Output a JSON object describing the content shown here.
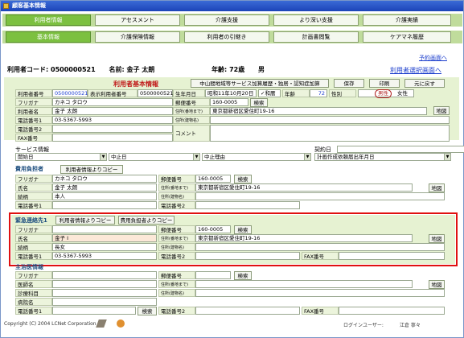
{
  "window": {
    "title": "顧客基本情報"
  },
  "nav1": [
    "利用者情報",
    "アセスメント",
    "介護支援",
    "より深い支援",
    "介護実績"
  ],
  "nav2": [
    "基本情報",
    "介護保険情報",
    "利用者の引継き",
    "計画書閲覧",
    "ケアマネ履歴"
  ],
  "links": {
    "schedule": "予約画面へ",
    "select_user": "利用者選択画面へ"
  },
  "header": {
    "code_label": "利用者コード:",
    "code": "0500000521",
    "name_label": "名前:",
    "name": "金子 太朗",
    "age_label": "年齢:",
    "age": "72歳",
    "sex": "男"
  },
  "basic": {
    "title": "利用者基本情報",
    "btn_kasan": "中山間地域等サービス加算履歴・独居・認知症加算",
    "btn_save": "保存",
    "btn_print": "印刷",
    "btn_back": "元に戻す",
    "user_no_label": "利用者番号",
    "user_no": "0500000521",
    "disp_no_label": "表示利用者番号",
    "disp_no": "0500000521",
    "birth_label": "生年月日",
    "birth": "昭和11年10月20日",
    "era": "和暦",
    "age_label": "年齢",
    "age": "72",
    "sex_label": "性別",
    "male": "男性",
    "female": "女性",
    "kana_label": "フリガナ",
    "kana": "カネコ タロウ",
    "zip_label": "郵便番号",
    "zip": "160-0005",
    "search": "検索",
    "name_label": "利用者名",
    "name": "金子 太朗",
    "addr_label": "住所(番地まで)",
    "addr": "東京都新宿区愛住町19-16",
    "bldg_label": "住所(建物名)",
    "map": "地図",
    "tel1_label": "電話番号1",
    "tel1": "03-5367-5993",
    "tel2_label": "電話番号2",
    "comment_label": "コメント",
    "fax_label": "FAX番号"
  },
  "service": {
    "title": "サービス情報",
    "contract": "契約日",
    "start": "開始日",
    "stop": "中止日",
    "reason": "中止理由",
    "plan": "計画作成依頼届出年月日"
  },
  "payer": {
    "title": "費用負担者",
    "copy": "利用者情報よりコピー",
    "kana_label": "フリガナ",
    "kana": "カネコ タロウ",
    "zip_label": "郵便番号",
    "zip": "160-0005",
    "search": "検索",
    "name_label": "氏名",
    "name": "金子 太朗",
    "addr_label": "住所(番地まで)",
    "addr": "東京都新宿区愛住町19-16",
    "rel_label": "続柄",
    "rel": "本人",
    "bldg_label": "住所(建物名)",
    "map": "地図",
    "tel1_label": "電話番号1",
    "tel2_label": "電話番号2"
  },
  "emergency": {
    "title": "緊急連絡先1",
    "copy1": "利用者情報よりコピー",
    "copy2": "費用負担者よりコピー",
    "kana_label": "フリガナ",
    "zip_label": "郵便番号",
    "zip": "160-0005",
    "search": "検索",
    "name_label": "氏名",
    "name": "金子 I",
    "addr_label": "住所(番地まで)",
    "addr": "東京都新宿区愛住町19-16",
    "rel_label": "続柄",
    "rel": "長女",
    "bldg_label": "住所(建物名)",
    "map": "地図",
    "tel1_label": "電話番号1",
    "tel1": "03-5367-5993",
    "tel2_label": "電話番号2",
    "fax_label": "FAX番号"
  },
  "doctor": {
    "title": "主治医情報",
    "kana_label": "フリガナ",
    "zip_label": "郵便番号",
    "search": "検索",
    "name_label": "医師名",
    "addr_label": "住所(番地まで)",
    "dept_label": "診療科目",
    "bldg_label": "住所(建物名)",
    "map": "地図",
    "hosp_label": "病院名",
    "tel1_label": "電話番号1",
    "tel2_label": "電話番号2",
    "fax_label": "FAX番号"
  },
  "footer": {
    "copyright": "Copyright (C) 2004 LCNet Corporation",
    "login": "ログインユーザー:",
    "user": "江倉 寧々"
  }
}
